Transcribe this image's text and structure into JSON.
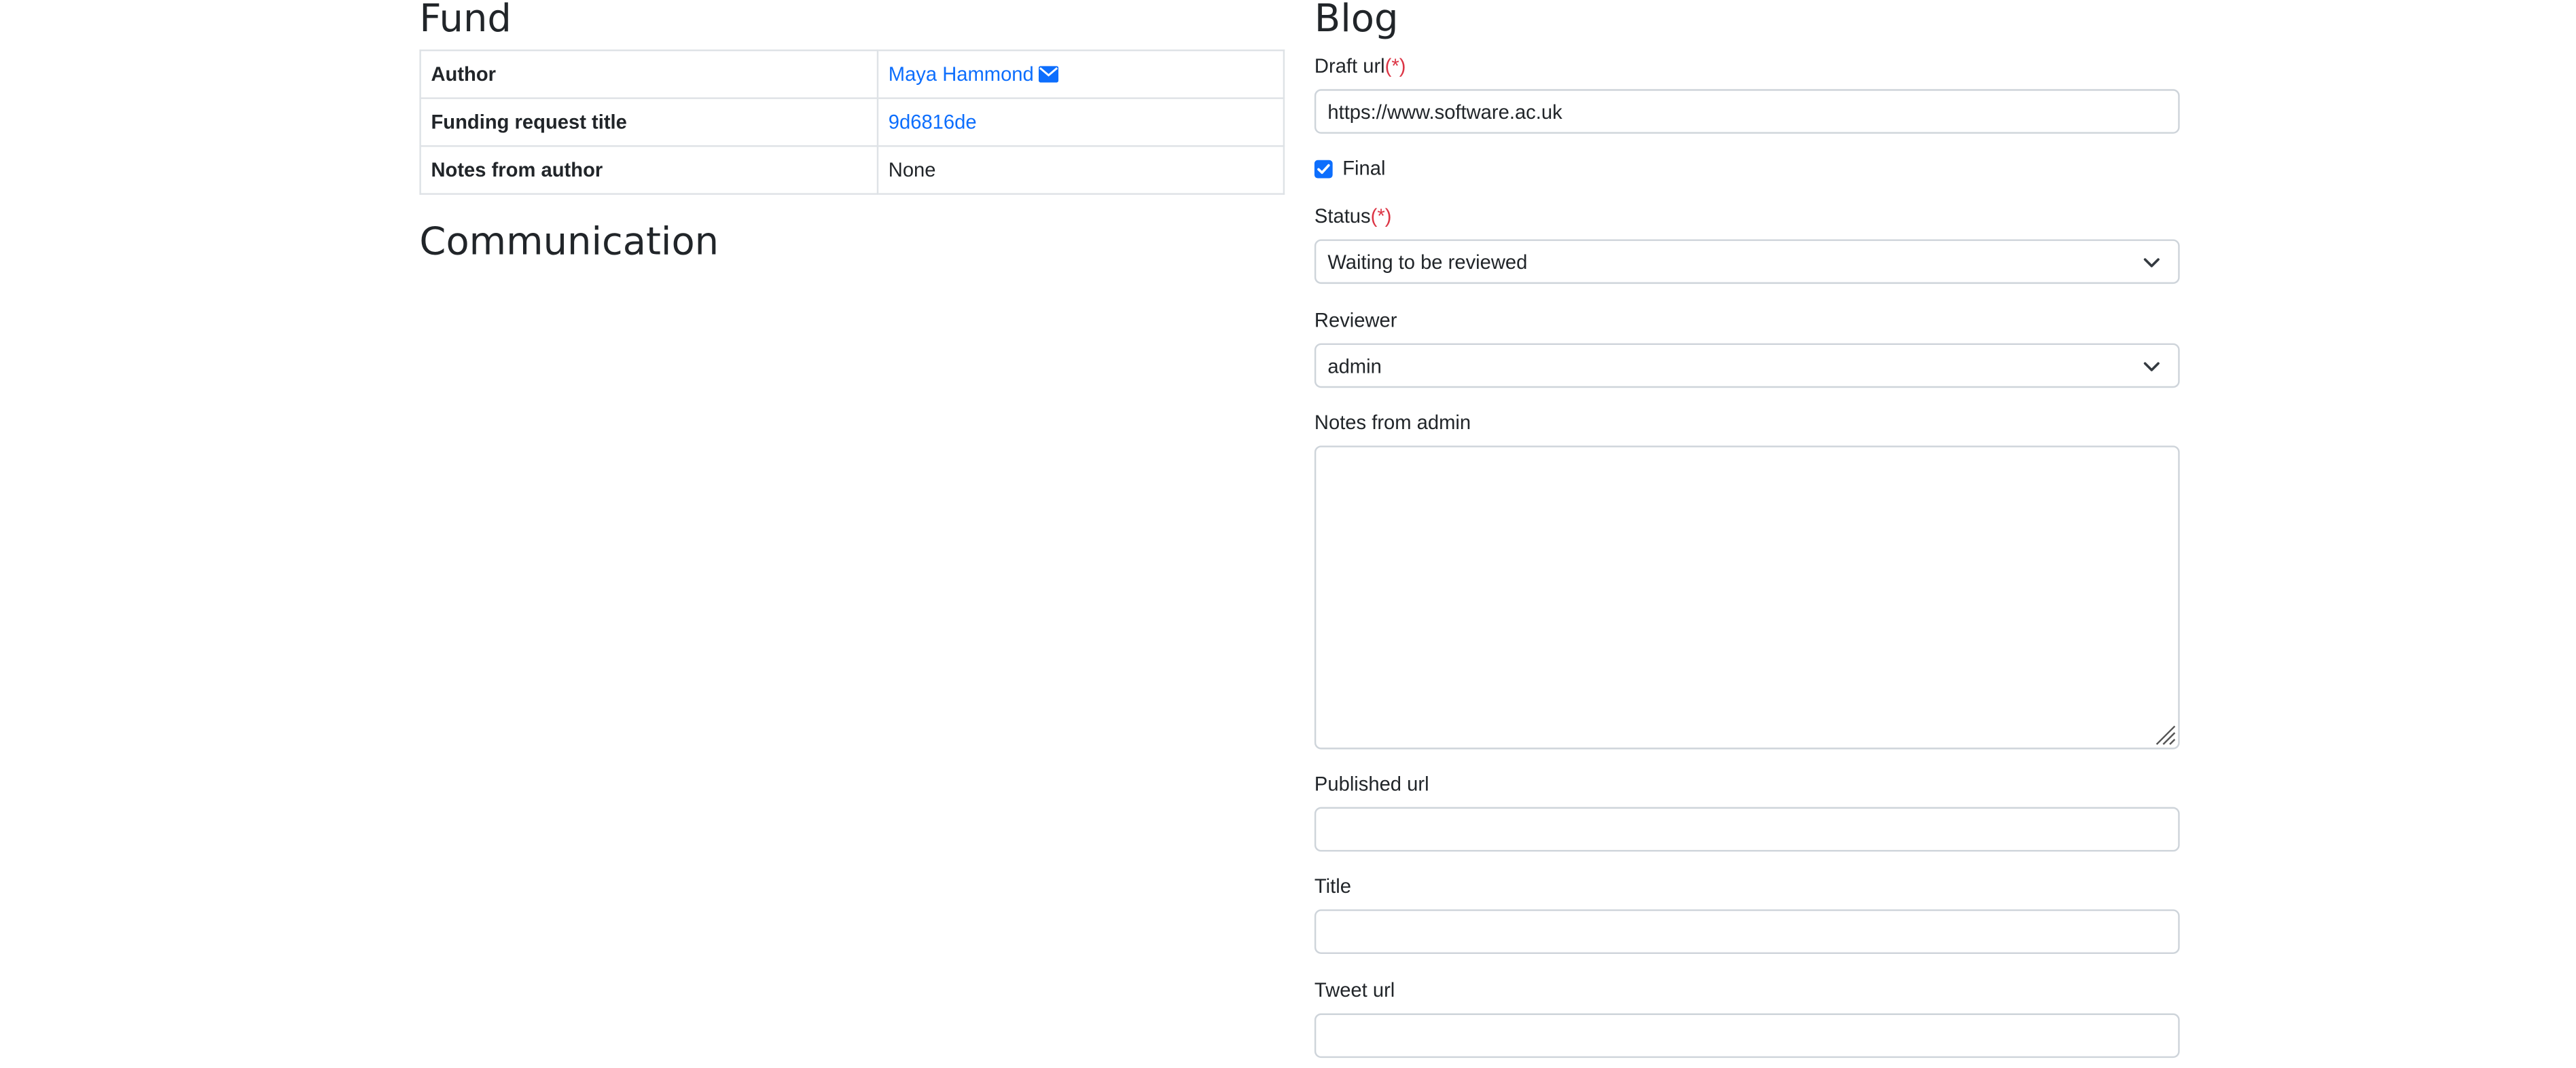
{
  "fund": {
    "heading": "Fund",
    "rows": [
      {
        "label": "Author",
        "value": "Maya Hammond",
        "type": "link-mail"
      },
      {
        "label": "Funding request title",
        "value": "9d6816de",
        "type": "link"
      },
      {
        "label": "Notes from author",
        "value": "None",
        "type": "text"
      }
    ]
  },
  "communication": {
    "heading": "Communication"
  },
  "blog": {
    "heading": "Blog",
    "required_marker": "(*)",
    "draft_url": {
      "label": "Draft url",
      "value": "https://www.software.ac.uk"
    },
    "final": {
      "label": "Final",
      "checked": true
    },
    "status": {
      "label": "Status",
      "value": "Waiting to be reviewed"
    },
    "reviewer": {
      "label": "Reviewer",
      "value": "admin"
    },
    "notes_from_admin": {
      "label": "Notes from admin",
      "value": ""
    },
    "published_url": {
      "label": "Published url",
      "value": ""
    },
    "title": {
      "label": "Title",
      "value": ""
    },
    "tweet_url": {
      "label": "Tweet url",
      "value": ""
    }
  },
  "colors": {
    "link": "#0d6efd",
    "required": "#dc3545",
    "border": "#ced4da",
    "checkbox": "#0d6efd"
  },
  "icons": [
    "envelope-icon",
    "chevron-down-icon",
    "check-icon",
    "resize-grip-icon"
  ]
}
